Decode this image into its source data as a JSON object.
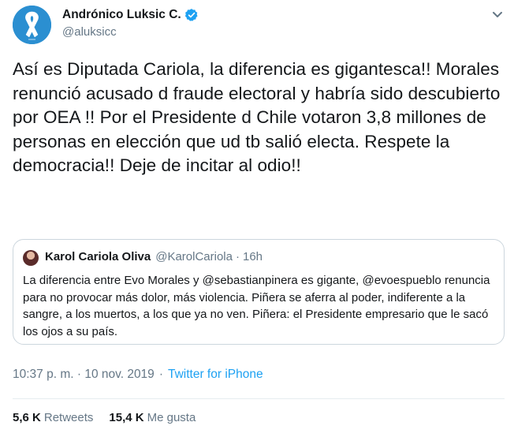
{
  "author": {
    "display_name": "Andrónico Luksic C.",
    "handle": "@aluksicc"
  },
  "tweet_text": "Así es Diputada Cariola, la diferencia es gigantesca!! Morales renunció acusado d fraude electoral y habría sido descubierto por OEA !! Por el Presidente d Chile votaron 3,8 millones de personas en elección que ud tb salió electa. Respete la democracia!! Deje de incitar al odio!!",
  "quoted_tweet": {
    "display_name": "Karol Cariola Oliva",
    "handle": "@KarolCariola",
    "separator": "·",
    "time": "16h",
    "text": "La diferencia entre Evo Morales y @sebastianpinera es gigante, @evoespueblo  renuncia para no provocar más dolor, más violencia. Piñera se aferra al poder, indiferente a la sangre, a los muertos, a los que ya no ven. Piñera: el Presidente empresario que le sacó los ojos a su país."
  },
  "meta": {
    "timestamp": "10:37 p. m. · 10 nov. 2019",
    "separator": "·",
    "source": "Twitter for iPhone"
  },
  "stats": {
    "retweets_count": "5,6 K",
    "retweets_label": "Retweets",
    "likes_count": "15,4 K",
    "likes_label": "Me gusta"
  },
  "icons": {
    "avatar": "ribbon-avatar",
    "verified": "verified-badge-icon",
    "menu": "chevron-down-icon"
  },
  "colors": {
    "link": "#1da1f2",
    "secondary_text": "#657786",
    "border": "#ccd6dd"
  }
}
